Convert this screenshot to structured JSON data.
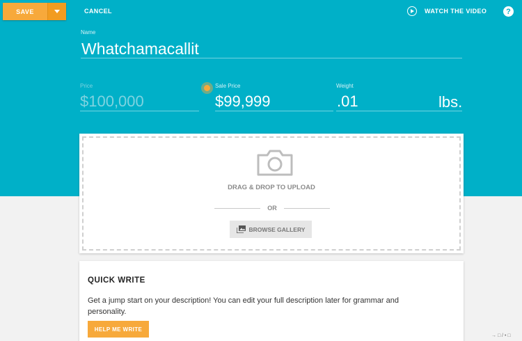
{
  "toolbar": {
    "save_label": "SAVE",
    "cancel_label": "CANCEL",
    "watch_label": "WATCH THE VIDEO",
    "help_label": "?"
  },
  "fields": {
    "name": {
      "label": "Name",
      "value": "Whatchamacallit"
    },
    "price": {
      "label": "Price",
      "value": "$100,000"
    },
    "sale_price": {
      "label": "Sale Price",
      "value": "$99,999"
    },
    "weight": {
      "label": "Weight",
      "value": ".01",
      "unit": "lbs."
    }
  },
  "upload": {
    "drag_text": "DRAG & DROP TO UPLOAD",
    "or_text": "OR",
    "browse_label": "BROWSE GALLERY"
  },
  "quick_write": {
    "title": "QUICK WRITE",
    "description": "Get a jump start on your description! You can edit your full description later for grammar and personality.",
    "button_label": "HELP ME WRITE"
  },
  "watermark": "→ □ / • □",
  "colors": {
    "header_bg": "#00b0c8",
    "accent": "#f7a93b",
    "page_bg": "#f2f2f2"
  }
}
